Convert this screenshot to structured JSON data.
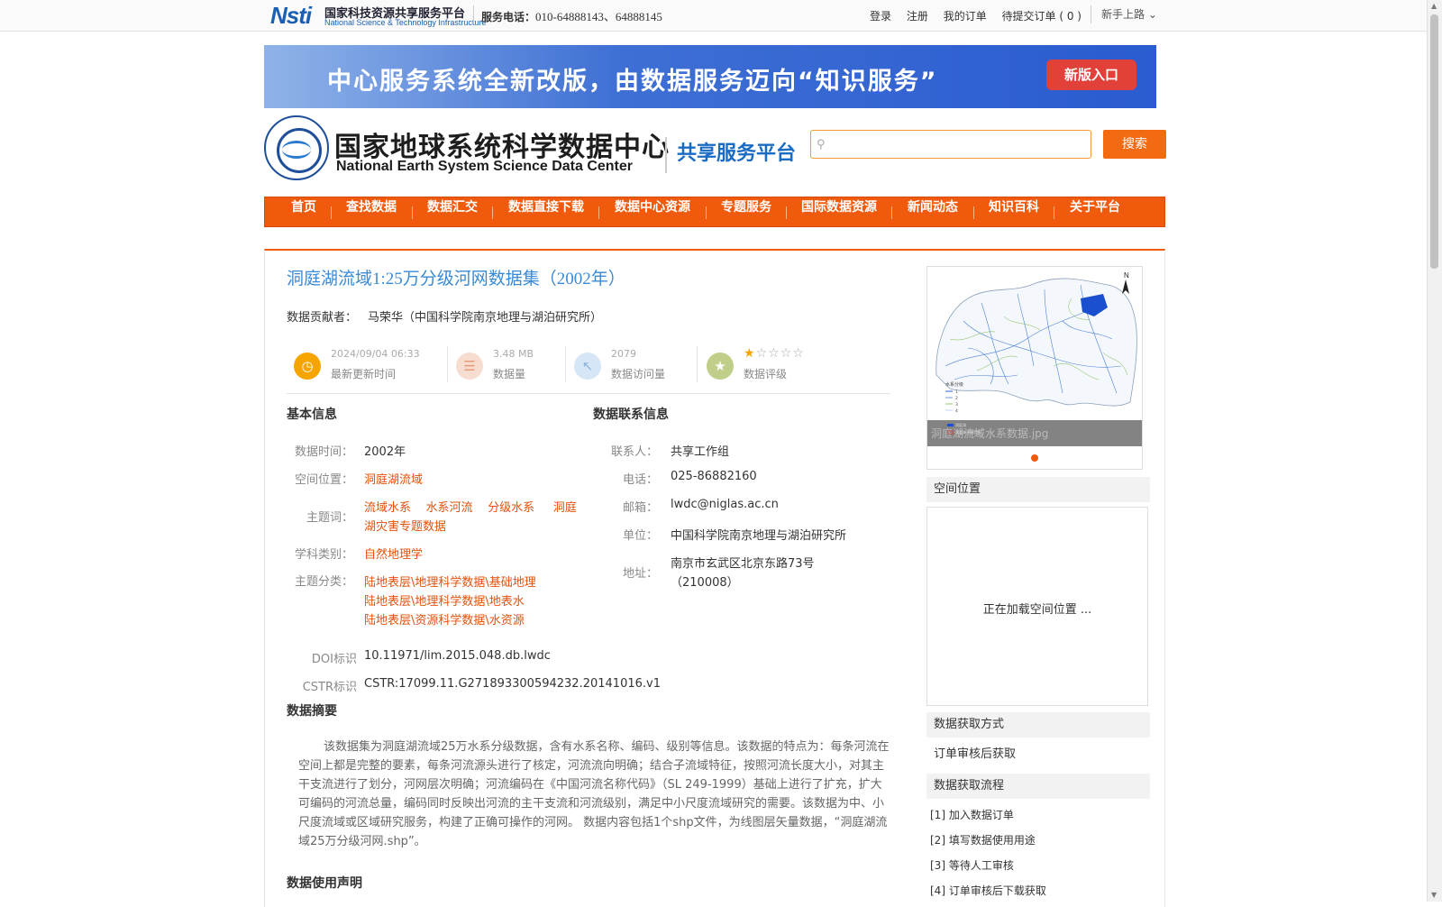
{
  "topbar": {
    "nsti_mark": "Nsti",
    "nsti_cn": "国家科技资源共享服务平台",
    "nsti_en": "National Science & Technology Infrastructure",
    "phone_label": "服务电话：",
    "phone_numbers": "010-64888143、64888145",
    "links": [
      "登录",
      "注册",
      "我的订单",
      "待提交订单 ( 0 )"
    ],
    "newbie": "新手上路"
  },
  "banner": {
    "text": "中心服务系统全新改版，由数据服务迈向“知识服务”",
    "button": "新版入口"
  },
  "logo": {
    "cn": "国家地球系统科学数据中心",
    "en": "National Earth System Science Data Center",
    "sub": "共享服务平台"
  },
  "search": {
    "placeholder": "",
    "button": "搜索"
  },
  "nav": [
    "首页",
    "查找数据",
    "数据汇交",
    "数据直接下载",
    "数据中心资源",
    "专题服务",
    "国际数据资源",
    "新闻动态",
    "知识百科",
    "关于平台"
  ],
  "dataset": {
    "title": "洞庭湖流域1:25万分级河网数据集（2002年）",
    "contributor_label": "数据贡献者：",
    "contributor": "马荣华（中国科学院南京地理与湖泊研究所）"
  },
  "stats": {
    "updated": {
      "value": "2024/09/04 06:33",
      "label": "最新更新时间"
    },
    "size": {
      "value": "3.48 MB",
      "label": "数据量"
    },
    "visits": {
      "value": "2079",
      "label": "数据访问量"
    },
    "rating": {
      "label": "数据评级",
      "stars": 1,
      "max": 5
    }
  },
  "basic": {
    "heading": "基本信息",
    "time_label": "数据时间：",
    "time": "2002年",
    "space_label": "空间位置：",
    "space": "洞庭湖流域",
    "kw_label": "主题词：",
    "kw1": "流域水系",
    "kw2": "水系河流",
    "kw3": "分级水系",
    "kw4a": "洞庭",
    "kw4b": "湖灾害专题数据",
    "subject_label": "学科类别：",
    "subject": "自然地理学",
    "cat_label": "主题分类：",
    "cat1": "陆地表层\\地理科学数据\\基础地理",
    "cat2": "陆地表层\\地理科学数据\\地表水",
    "cat3": "陆地表层\\资源科学数据\\水资源",
    "doi_label": "DOI标识",
    "doi": "10.11971/lim.2015.048.db.lwdc",
    "cstr_label": "CSTR标识",
    "cstr": "CSTR:17099.11.G271893300594232.20141016.v1"
  },
  "contact": {
    "heading": "数据联系信息",
    "person_label": "联系人：",
    "person": "共享工作组",
    "tel_label": "电话：",
    "tel": "025-86882160",
    "email_label": "邮箱：",
    "email": "lwdc@niglas.ac.cn",
    "unit_label": "单位：",
    "unit": "中国科学院南京地理与湖泊研究所",
    "addr_label": "地址：",
    "addr1": "南京市玄武区北京东路73号",
    "addr2": "（210008）"
  },
  "abstract": {
    "heading": "数据摘要",
    "text": "该数据集为洞庭湖流域25万水系分级数据，含有水系名称、编码、级别等信息。该数据的特点为：每条河流在空间上都是完整的要素，每条河流源头进行了核定，河流流向明确；结合子流域特征，按照河流长度大小，对其主干支流进行了划分，河网层次明确；河流编码在《中国河流名称代码》（SL 249-1999）基础上进行了扩充，扩大可编码的河流总量，编码同时反映出河流的主干支流和河流级别，满足中小尺度流域研究的需要。该数据为中、小尺度流域或区域研究服务，构建了正确可操作的河网。 数据内容包括1个shp文件，为线图层矢量数据，“洞庭湖流域25万分级河网.shp”。"
  },
  "usage_heading": "数据使用声明",
  "sidebar": {
    "thumb_caption": "洞庭湖流域水系数据.jpg",
    "legend_title": "水系分级",
    "legend_items": [
      "1",
      "2",
      "3",
      "4",
      "洞庭湖",
      "洞庭湖流域范围"
    ],
    "north": "N",
    "spatial_heading": "空间位置",
    "loading": "正在加载空间位置 ...",
    "method_heading": "数据获取方式",
    "method": "订单审核后获取",
    "flow_heading": "数据获取流程",
    "steps": [
      "[1] 加入数据订单",
      "[2] 填写数据使用用途",
      "[3] 等待人工审核",
      "[4] 订单审核后下载获取"
    ]
  }
}
